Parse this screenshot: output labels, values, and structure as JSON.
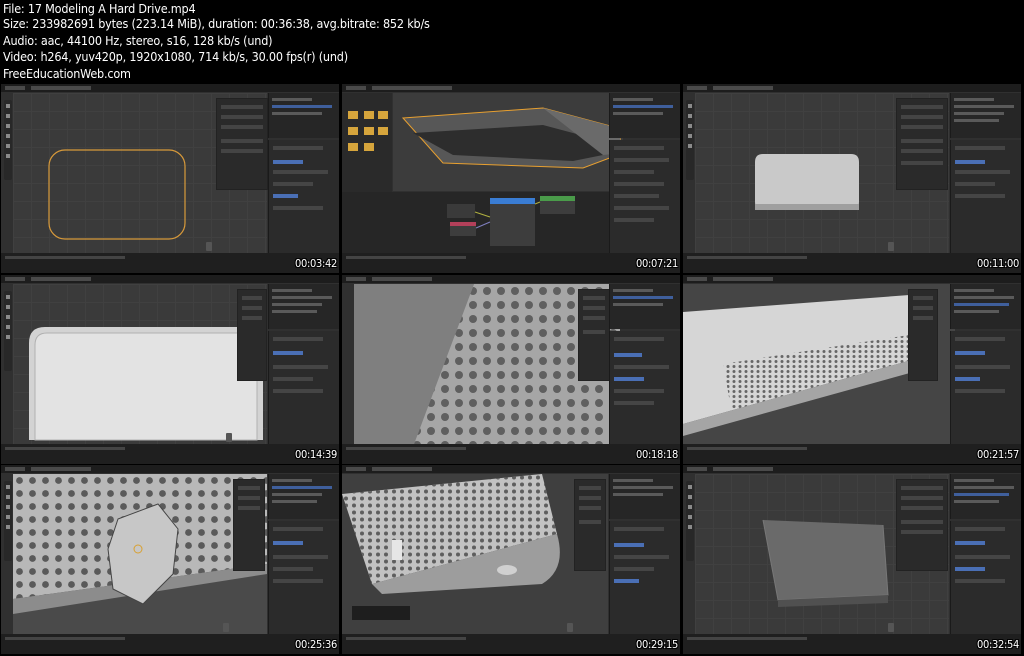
{
  "header": {
    "file": "File: 17 Modeling A Hard Drive.mp4",
    "size": "Size: 233982691 bytes (223.14 MiB), duration: 00:36:38, avg.bitrate: 852 kb/s",
    "audio": "Audio: aac, 44100 Hz, stereo, s16, 128 kb/s (und)",
    "video": "Video: h264, yuv420p, 1920x1080, 714 kb/s, 30.00 fps(r) (und)",
    "site": "FreeEducationWeb.com"
  },
  "thumbnails": [
    {
      "timestamp": "00:03:42"
    },
    {
      "timestamp": "00:07:21"
    },
    {
      "timestamp": "00:11:00"
    },
    {
      "timestamp": "00:14:39"
    },
    {
      "timestamp": "00:18:18"
    },
    {
      "timestamp": "00:21:57"
    },
    {
      "timestamp": "00:25:36"
    },
    {
      "timestamp": "00:29:15"
    },
    {
      "timestamp": "00:32:54"
    }
  ],
  "colors": {
    "ui_dark": "#1d1d1d",
    "viewport": "#3a3a3a",
    "selection_blue": "#3f5f9c",
    "object_outline": "#e8a030",
    "model_gray": "#b9b9b9"
  }
}
